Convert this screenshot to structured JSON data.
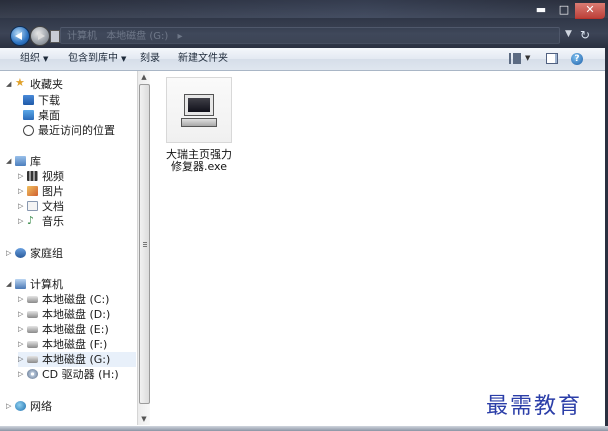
{
  "window": {
    "controls": {
      "minimize": "▬",
      "maximize": "□",
      "close": "✕"
    },
    "address_segments": [
      "计算机",
      "本地磁盘 (G:)",
      "▸"
    ]
  },
  "toolbar": {
    "organize": "组织",
    "include_in_library": "包含到库中",
    "burn": "刻录",
    "new_folder": "新建文件夹"
  },
  "nav": {
    "favorites": {
      "label": "收藏夹",
      "items": [
        "下载",
        "桌面",
        "最近访问的位置"
      ]
    },
    "libraries": {
      "label": "库",
      "items": [
        "视频",
        "图片",
        "文档",
        "音乐"
      ]
    },
    "homegroup": "家庭组",
    "computer": {
      "label": "计算机",
      "items": [
        "本地磁盘 (C:)",
        "本地磁盘 (D:)",
        "本地磁盘 (E:)",
        "本地磁盘 (F:)",
        "本地磁盘 (G:)",
        "CD 驱动器 (H:)"
      ]
    },
    "network": "网络"
  },
  "files": [
    {
      "name": "大瑞主页强力修复器.exe"
    }
  ],
  "watermark": "最需教育",
  "colors": {
    "titlebar": "#2f3646",
    "toolbar": "#e3e9f2",
    "selection": "#e8f0fa",
    "watermark": "#2b3ea8"
  }
}
